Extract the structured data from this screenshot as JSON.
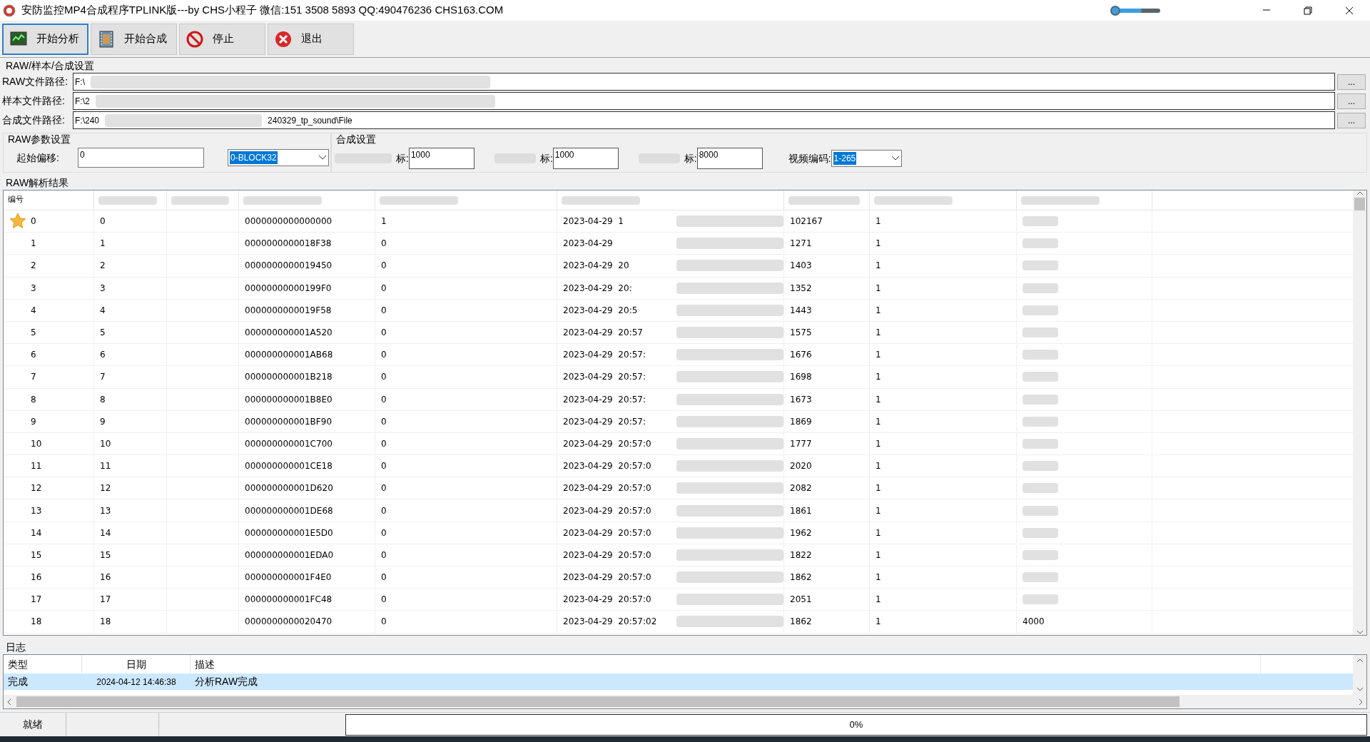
{
  "window": {
    "title": "安防监控MP4合成程序TPLINK版---by CHS小程子 微信:151 3508 5893 QQ:490476236 CHS163.COM",
    "slider": {
      "level": 0.6
    }
  },
  "toolbar": [
    {
      "label": "开始分析",
      "kind": "monitor",
      "focused": true
    },
    {
      "label": "开始合成",
      "kind": "film",
      "focused": false
    },
    {
      "label": "停止",
      "kind": "stop",
      "focused": false
    },
    {
      "label": "退出",
      "kind": "exit",
      "focused": false
    }
  ],
  "paths": {
    "title": "RAW/样本/合成设置",
    "rows": [
      {
        "label": "RAW文件路径:",
        "value": "F:\\"
      },
      {
        "label": "样本文件路径:",
        "value": "F:\\2"
      },
      {
        "label": "合成文件路径:",
        "value": "F:\\240",
        "tail": "240329_tp_sound\\File"
      }
    ],
    "browse": "..."
  },
  "raw_params": {
    "title": "RAW参数设置",
    "offset_label": "起始偏移:",
    "offset_value": "0",
    "block_value": "0-BLOCK32"
  },
  "compose": {
    "title": "合成设置",
    "fields": [
      {
        "label": "标:",
        "value": "1000"
      },
      {
        "label": "标:",
        "value": "1000"
      },
      {
        "label": "标:",
        "value": "8000"
      }
    ],
    "codec_label": "视频编码:",
    "codec_value": "1-265"
  },
  "results": {
    "title": "RAW解析结果",
    "header": "编号",
    "rows": [
      {
        "marked": true,
        "c1": "0",
        "c2": "0",
        "c3": "0000000000000000",
        "c4": "1",
        "c5": "2023-04-29  1",
        "c6": "102167",
        "c7": "1"
      },
      {
        "marked": false,
        "c1": "1",
        "c2": "1",
        "c3": "0000000000018F38",
        "c4": "0",
        "c5": "2023-04-29",
        "c6": "1271",
        "c7": "1"
      },
      {
        "marked": false,
        "c1": "2",
        "c2": "2",
        "c3": "0000000000019450",
        "c4": "0",
        "c5": "2023-04-29  20",
        "c6": "1403",
        "c7": "1"
      },
      {
        "marked": false,
        "c1": "3",
        "c2": "3",
        "c3": "00000000000199F0",
        "c4": "0",
        "c5": "2023-04-29  20:",
        "c6": "1352",
        "c7": "1"
      },
      {
        "marked": false,
        "c1": "4",
        "c2": "4",
        "c3": "0000000000019F58",
        "c4": "0",
        "c5": "2023-04-29  20:5",
        "c6": "1443",
        "c7": "1"
      },
      {
        "marked": false,
        "c1": "5",
        "c2": "5",
        "c3": "000000000001A520",
        "c4": "0",
        "c5": "2023-04-29  20:57",
        "c6": "1575",
        "c7": "1"
      },
      {
        "marked": false,
        "c1": "6",
        "c2": "6",
        "c3": "000000000001AB68",
        "c4": "0",
        "c5": "2023-04-29  20:57:",
        "c6": "1676",
        "c7": "1"
      },
      {
        "marked": false,
        "c1": "7",
        "c2": "7",
        "c3": "000000000001B218",
        "c4": "0",
        "c5": "2023-04-29  20:57:",
        "c6": "1698",
        "c7": "1"
      },
      {
        "marked": false,
        "c1": "8",
        "c2": "8",
        "c3": "000000000001B8E0",
        "c4": "0",
        "c5": "2023-04-29  20:57:",
        "c6": "1673",
        "c7": "1"
      },
      {
        "marked": false,
        "c1": "9",
        "c2": "9",
        "c3": "000000000001BF90",
        "c4": "0",
        "c5": "2023-04-29  20:57:",
        "c6": "1869",
        "c7": "1"
      },
      {
        "marked": false,
        "c1": "10",
        "c2": "10",
        "c3": "000000000001C700",
        "c4": "0",
        "c5": "2023-04-29  20:57:0",
        "c6": "1777",
        "c7": "1"
      },
      {
        "marked": false,
        "c1": "11",
        "c2": "11",
        "c3": "000000000001CE18",
        "c4": "0",
        "c5": "2023-04-29  20:57:0",
        "c6": "2020",
        "c7": "1"
      },
      {
        "marked": false,
        "c1": "12",
        "c2": "12",
        "c3": "000000000001D620",
        "c4": "0",
        "c5": "2023-04-29  20:57:0",
        "c6": "2082",
        "c7": "1"
      },
      {
        "marked": false,
        "c1": "13",
        "c2": "13",
        "c3": "000000000001DE68",
        "c4": "0",
        "c5": "2023-04-29  20:57:0",
        "c6": "1861",
        "c7": "1"
      },
      {
        "marked": false,
        "c1": "14",
        "c2": "14",
        "c3": "000000000001E5D0",
        "c4": "0",
        "c5": "2023-04-29  20:57:0",
        "c6": "1962",
        "c7": "1"
      },
      {
        "marked": false,
        "c1": "15",
        "c2": "15",
        "c3": "000000000001EDA0",
        "c4": "0",
        "c5": "2023-04-29  20:57:0",
        "c6": "1822",
        "c7": "1"
      },
      {
        "marked": false,
        "c1": "16",
        "c2": "16",
        "c3": "000000000001F4E0",
        "c4": "0",
        "c5": "2023-04-29  20:57:0",
        "c6": "1862",
        "c7": "1"
      },
      {
        "marked": false,
        "c1": "17",
        "c2": "17",
        "c3": "000000000001FC48",
        "c4": "0",
        "c5": "2023-04-29  20:57:0",
        "c6": "2051",
        "c7": "1"
      },
      {
        "marked": false,
        "c1": "18",
        "c2": "18",
        "c3": "0000000000020470",
        "c4": "0",
        "c5": "2023-04-29  20:57:02",
        "c6": "1862",
        "c7": "1",
        "c8": "4000"
      }
    ]
  },
  "log": {
    "title": "日志",
    "columns": [
      "类型",
      "日期",
      "描述"
    ],
    "rows": [
      {
        "selected": true,
        "type": "完成",
        "date": "2024-04-12 14:46:38",
        "desc": "分析RAW完成"
      }
    ]
  },
  "status_bar": {
    "state": "就绪",
    "progress_label": "0%",
    "level": 0
  }
}
